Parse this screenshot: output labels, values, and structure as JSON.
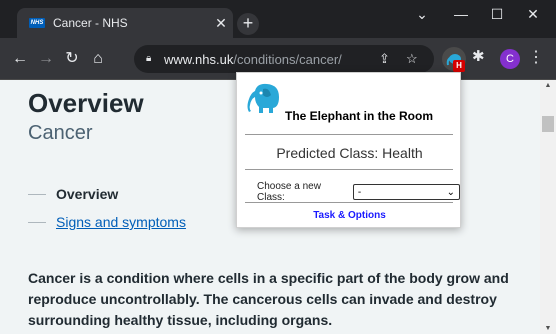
{
  "browser": {
    "tab": {
      "title": "Cancer - NHS",
      "favicon": "NHS"
    },
    "url": {
      "host": "www.nhs.uk",
      "path": "/conditions/cancer/"
    },
    "profile_initial": "C",
    "extension_badge": "H"
  },
  "page": {
    "title": "Overview",
    "subtitle": "Cancer",
    "contents": [
      {
        "label": "Overview",
        "current": true
      },
      {
        "label": "Signs and symptoms",
        "current": false
      }
    ],
    "intro": "Cancer is a condition where cells in a specific part of the body grow and reproduce uncontrollably. The cancerous cells can invade and destroy surrounding healthy tissue, including organs."
  },
  "popup": {
    "title": "The Elephant in the Room",
    "predicted": "Predicted Class: Health",
    "choose_label": "Choose a new Class:",
    "select_value": "-",
    "task_link": "Task & Options"
  },
  "colors": {
    "nhs_blue": "#005eb8",
    "elephant": "#29a8d8",
    "badge_red": "#d50000"
  }
}
